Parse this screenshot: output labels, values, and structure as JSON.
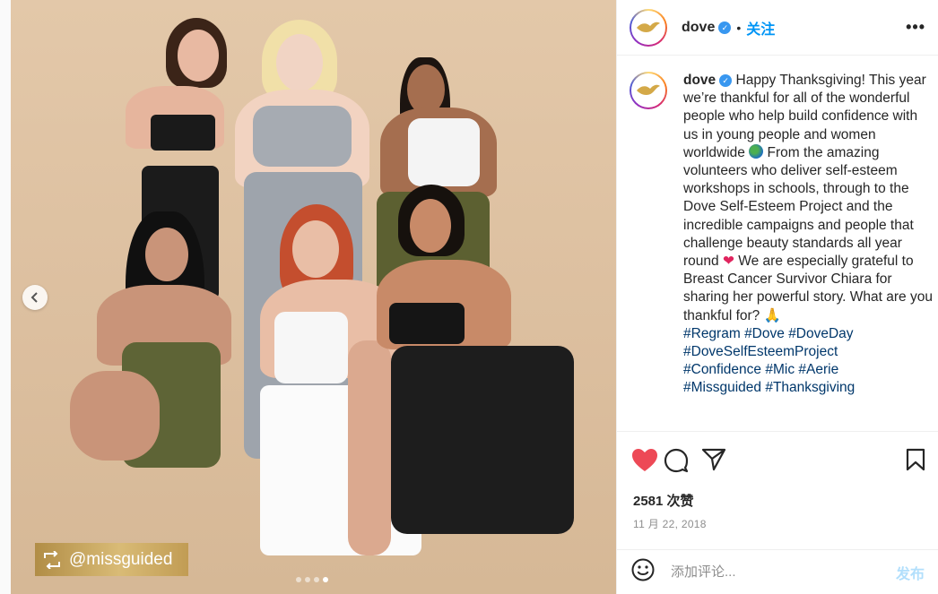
{
  "post": {
    "watermark_text": "@missguided",
    "carousel": {
      "slide_count": 4,
      "active_slide": 4
    }
  },
  "header": {
    "username": "dove",
    "separator": "•",
    "follow_label": "关注",
    "more_label": "•••",
    "verified": true
  },
  "caption": {
    "username": "dove",
    "text_1": "Happy Thanksgiving! This year we’re thankful for all of the wonderful people who help build confidence with us in young people and women worldwide",
    "text_2": "From the amazing volunteers who deliver self-esteem workshops in schools, through to the Dove Self-Esteem Project and the incredible campaigns and people that challenge beauty standards all year round",
    "text_3": "We are especially grateful to Breast Cancer Survivor Chiara for sharing her powerful story. What are you thankful for?",
    "hashtags": [
      "#Regram",
      "#Dove",
      "#DoveDay",
      "#DoveSelfEsteemProject",
      "#Confidence",
      "#Mic",
      "#Aerie",
      "#Missguided",
      "#Thanksgiving"
    ]
  },
  "stats": {
    "likes": "2581 次赞",
    "date": "11 月 22, 2018"
  },
  "comment": {
    "placeholder": "添加评论...",
    "post_label": "发布"
  },
  "colors": {
    "accent": "#0095f6",
    "heart": "#ed4956",
    "verified": "#3897f0",
    "hashtag": "#00376b",
    "photo_bg": "#e0c4a4"
  },
  "icons": [
    "chevron-left-icon",
    "repost-icon",
    "dove-logo-icon",
    "verified-icon",
    "globe-emoji-icon",
    "red-heart-emoji-icon",
    "praying-hands-emoji-icon",
    "heart-icon",
    "comment-icon",
    "share-icon",
    "bookmark-icon",
    "smiley-icon"
  ]
}
